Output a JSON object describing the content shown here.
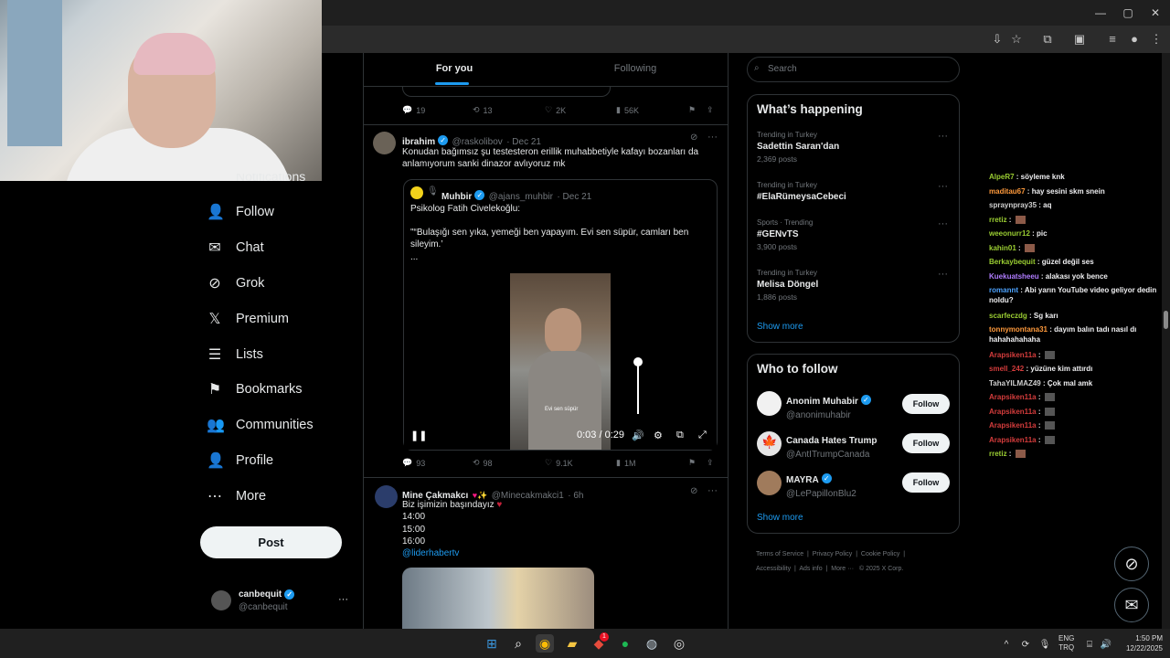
{
  "window_controls": {
    "minimize": "—",
    "maximize": "▢",
    "close": "✕"
  },
  "nav": {
    "partial_label": "Notifications",
    "items": [
      {
        "label": "Follow",
        "icon": "follow-icon"
      },
      {
        "label": "Chat",
        "icon": "chat-icon"
      },
      {
        "label": "Grok",
        "icon": "grok-icon"
      },
      {
        "label": "Premium",
        "icon": "x-logo-icon"
      },
      {
        "label": "Lists",
        "icon": "lists-icon"
      },
      {
        "label": "Bookmarks",
        "icon": "bookmark-icon"
      },
      {
        "label": "Communities",
        "icon": "communities-icon"
      },
      {
        "label": "Profile",
        "icon": "profile-icon"
      },
      {
        "label": "More",
        "icon": "more-icon"
      }
    ],
    "post_label": "Post",
    "account": {
      "name": "canbequit",
      "handle": "@canbequit",
      "menu": "···"
    }
  },
  "tabs": {
    "for_you": "For you",
    "following": "Following"
  },
  "tweet0": {
    "replies": "19",
    "retweets": "13",
    "likes": "2K",
    "views": "56K"
  },
  "tweet1": {
    "name": "ibrahim",
    "handle": "@raskolibov",
    "date": "· Dec 21",
    "text": "Konudan bağımsız şu testesteron erillik muhabbetiyle kafayı bozanları da anlamıyorum sanki dinazor avlıyoruz mk",
    "quote": {
      "name": "Muhbir",
      "handle": "@ajans_muhbir",
      "date": "· Dec 21",
      "line1": "Psikolog Fatih Civelekoğlu:",
      "line2": "\"“Bulaşığı sen yıka, yemeği ben yapayım. Evi sen süpür, camları ben sileyim.’",
      "line3": "..."
    },
    "video": {
      "time": "0:03 / 0:29",
      "caption": "Evi sen süpür",
      "volume": 1.0
    },
    "replies": "93",
    "retweets": "98",
    "likes": "9.1K",
    "views": "1M"
  },
  "tweet2": {
    "name": "Mine Çakmakcı",
    "handle": "@Minecakmakci1",
    "date": "· 6h",
    "line1": "Biz işimizin başındayız",
    "line2": "14:00",
    "line3": "15:00",
    "line4": "16:00",
    "link": "@liderhabertv"
  },
  "search": {
    "placeholder": "Search"
  },
  "trends": {
    "title": "What’s happening",
    "items": [
      {
        "context": "Trending in Turkey",
        "name": "Sadettin Saran'dan",
        "posts": "2,369 posts"
      },
      {
        "context": "Trending in Turkey",
        "name": "#ElaRümeysaCebeci",
        "posts": ""
      },
      {
        "context": "Sports · Trending",
        "name": "#GENvTS",
        "posts": "3,900 posts"
      },
      {
        "context": "Trending in Turkey",
        "name": "Melisa Döngel",
        "posts": "1,886 posts"
      }
    ],
    "show_more": "Show more"
  },
  "who_to_follow": {
    "title": "Who to follow",
    "items": [
      {
        "name": "Anonim Muhabir",
        "handle": "@anonimuhabir",
        "button": "Follow"
      },
      {
        "name": "Canada Hates Trump",
        "handle": "@AntITrumpCanada",
        "button": "Follow"
      },
      {
        "name": "MAYRA",
        "handle": "@LePapillonBlu2",
        "button": "Follow"
      }
    ],
    "show_more": "Show more"
  },
  "footer": {
    "terms": "Terms of Service",
    "privacy": "Privacy Policy",
    "cookie": "Cookie Policy",
    "accessibility": "Accessibility",
    "ads": "Ads info",
    "more": "More ···",
    "copyright": "© 2025 X Corp."
  },
  "chat": [
    {
      "user": "AlpeR7",
      "color": "#9acd32",
      "msg": "söyleme knk"
    },
    {
      "user": "maditau67",
      "color": "#ff9a3c",
      "msg": "hay sesini skm snein"
    },
    {
      "user": "sprаynpray35",
      "color": "#d0d0d0",
      "msg": "aq"
    },
    {
      "user": "rretiz",
      "color": "#9acd32",
      "msg": ""
    },
    {
      "user": "weeonurr12",
      "color": "#9acd32",
      "msg": "pic"
    },
    {
      "user": "kahin01",
      "color": "#9acd32",
      "msg": ""
    },
    {
      "user": "Berkaybequit",
      "color": "#9acd32",
      "msg": "güzel değil ses"
    },
    {
      "user": "Kuekuatsheeu",
      "color": "#b07cff",
      "msg": "alakası yok bence"
    },
    {
      "user": "romannt",
      "color": "#4da3ff",
      "msg": "Abi yarın YouTube video geliyor dedin noldu?"
    },
    {
      "user": "scarfeczdg",
      "color": "#9acd32",
      "msg": "Sg karı"
    },
    {
      "user": "tonnymontana31",
      "color": "#ff9a3c",
      "msg": "dayım balın tadı nasıl dı hahahahahaha"
    },
    {
      "user": "Arapsiken11a",
      "color": "#d43c3c",
      "msg": ""
    },
    {
      "user": "smell_242",
      "color": "#d43c3c",
      "msg": "yüzüne kim attırdı"
    },
    {
      "user": "TahaYILMAZ49",
      "color": "#d0d0d0",
      "msg": "Çok mal amk"
    },
    {
      "user": "Arapsiken11a",
      "color": "#d43c3c",
      "msg": ""
    },
    {
      "user": "Arapsiken11a",
      "color": "#d43c3c",
      "msg": ""
    },
    {
      "user": "Arapsiken11a",
      "color": "#d43c3c",
      "msg": ""
    },
    {
      "user": "Arapsiken11a",
      "color": "#d43c3c",
      "msg": ""
    },
    {
      "user": "rretiz",
      "color": "#9acd32",
      "msg": ""
    }
  ],
  "taskbar": {
    "lang1": "ENG",
    "lang2": "TRQ",
    "time": "1:50 PM",
    "date": "12/22/2025",
    "badge": "1"
  }
}
